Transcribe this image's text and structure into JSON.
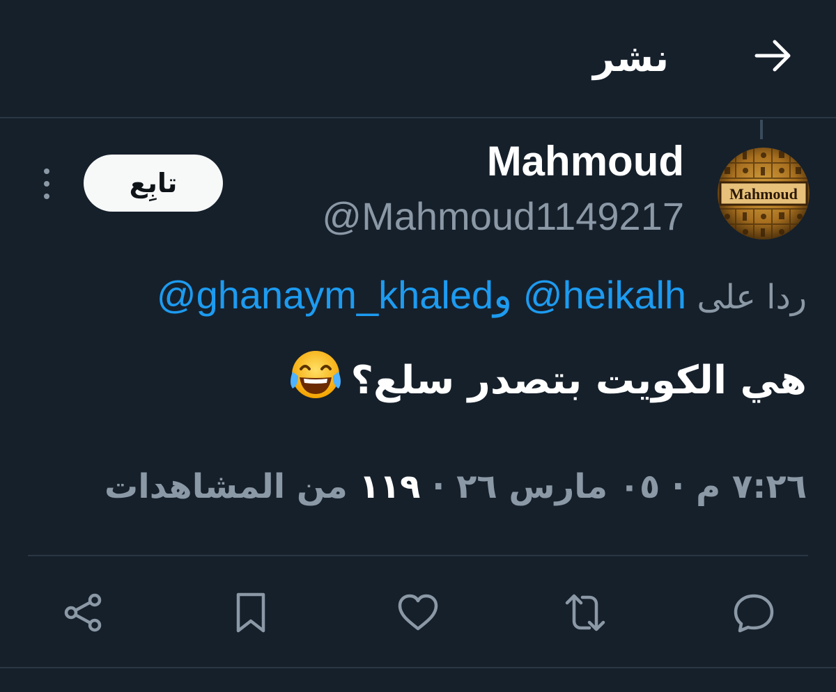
{
  "header": {
    "title": "نشر",
    "back_icon": "arrow-right-icon"
  },
  "tweet": {
    "author": {
      "display_name": "Mahmoud",
      "handle": "@Mahmoud1149217",
      "avatar_text": "Mahmoud"
    },
    "follow_label": "تابِع",
    "reply_to": {
      "prefix": "ردا على",
      "mention1": "@ghanaym_khaled",
      "conjunction": "و",
      "mention2": "@heikalh"
    },
    "text": "هي الكويت بتصدر سلع؟",
    "emoji": "face-with-tears-of-joy",
    "meta": {
      "time": "٧:٢٦ م",
      "date": "٠٥ مارس ٢٦ ·",
      "separator": "·",
      "views_count": "١١٩",
      "views_label": "من المشاهدات"
    }
  },
  "actions": [
    {
      "name": "reply",
      "icon": "speech-bubble-icon"
    },
    {
      "name": "retweet",
      "icon": "retweet-icon"
    },
    {
      "name": "like",
      "icon": "heart-icon"
    },
    {
      "name": "bookmark",
      "icon": "bookmark-icon"
    },
    {
      "name": "share",
      "icon": "share-icon"
    }
  ],
  "colors": {
    "background": "#16202b",
    "primary_text": "#ffffff",
    "secondary_text": "#8b98a5",
    "link": "#1d9bf0",
    "divider": "#2a3744"
  }
}
